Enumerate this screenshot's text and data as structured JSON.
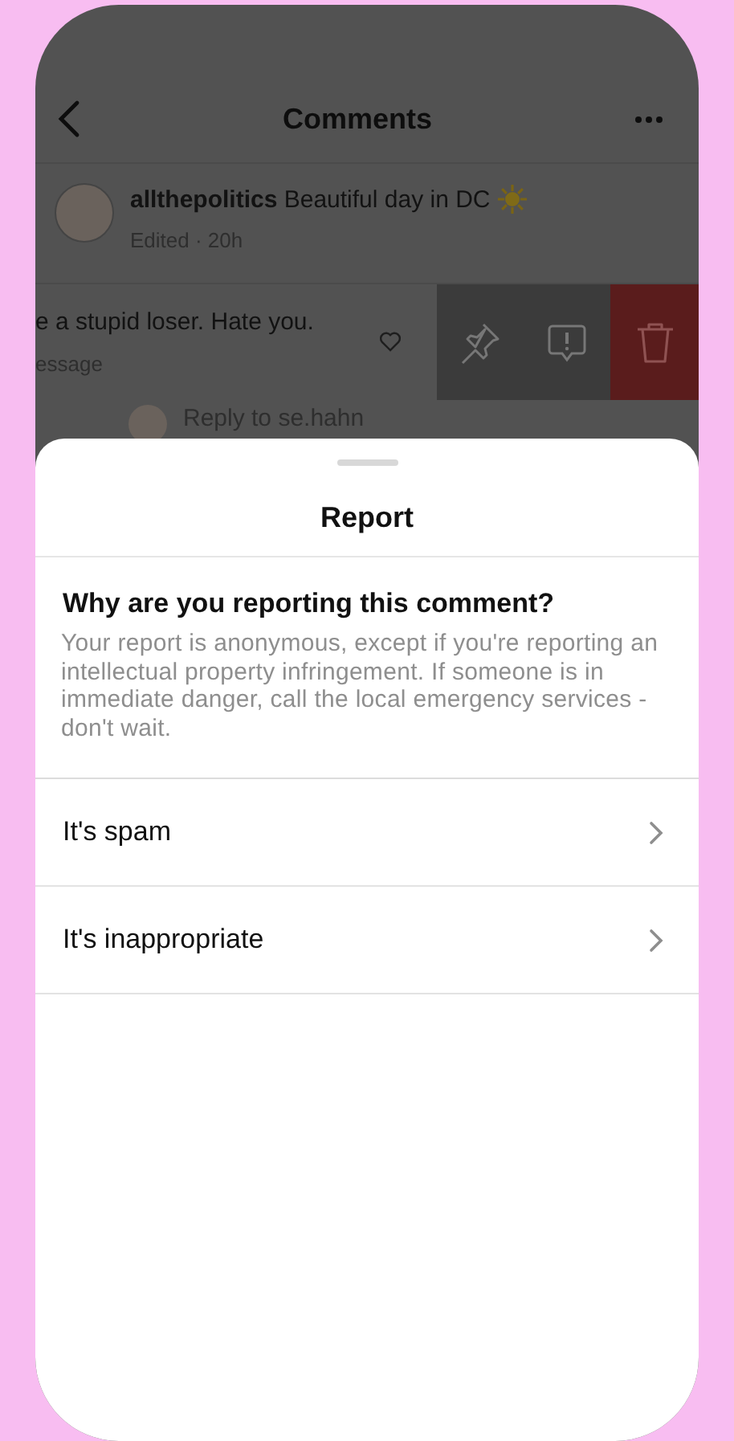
{
  "header": {
    "title": "Comments"
  },
  "post": {
    "username": "allthepolitics",
    "caption": "Beautiful day in DC",
    "meta": "Edited · 20h"
  },
  "comment": {
    "text": "e a stupid loser. Hate you.",
    "meta": "essage"
  },
  "swipe_actions": [
    {
      "kind": "pin"
    },
    {
      "kind": "report"
    },
    {
      "kind": "delete"
    }
  ],
  "reply": {
    "text": "Reply to se.hahn"
  },
  "sheet": {
    "title": "Report",
    "question": "Why are you reporting this comment?",
    "note": "Your report is anonymous, except if you're reporting an intellectual property infringement. If someone is in immediate danger, call the local emergency services - don't wait.",
    "options": [
      {
        "label": "It's spam"
      },
      {
        "label": "It's inappropriate"
      }
    ]
  }
}
